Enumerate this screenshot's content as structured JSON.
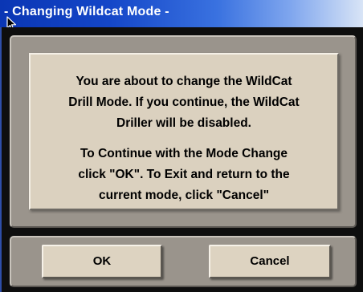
{
  "window": {
    "title": "- Changing Wildcat Mode -"
  },
  "message": {
    "lines": [
      "You are about to change the WildCat",
      "Drill Mode.  If you continue, the WildCat",
      "Driller will be disabled.",
      "To Continue with the Mode Change",
      "click \"OK\".  To Exit and return to the",
      "current mode, click \"Cancel\""
    ]
  },
  "buttons": {
    "ok_label": "OK",
    "cancel_label": "Cancel"
  },
  "colors": {
    "titlebar_start": "#0a36b4",
    "panel_bg": "#dbd1bf",
    "frame_bg": "#0e0e0e"
  },
  "icons": {
    "cursor": "mouse-pointer-icon"
  }
}
